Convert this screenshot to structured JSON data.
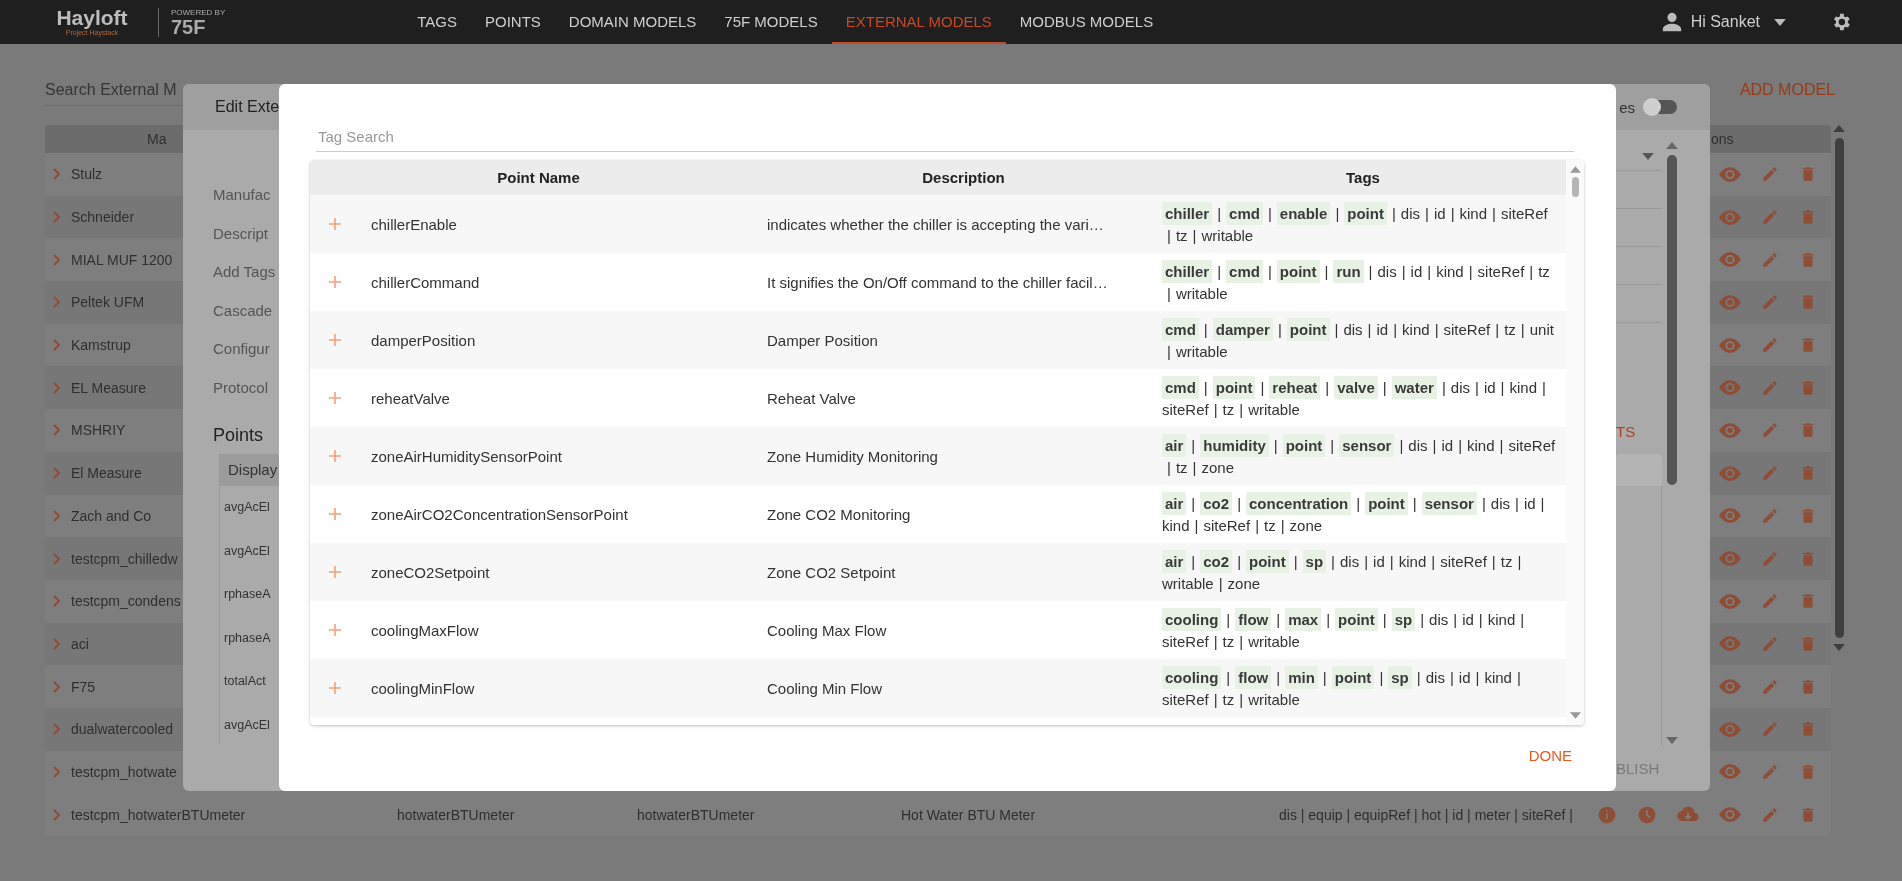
{
  "header": {
    "logo": "Hayloft",
    "logo_subtitle": "Project Haystack",
    "powered_by": "POWERED BY",
    "brand": "75F",
    "nav": [
      {
        "label": "TAGS",
        "selected": false
      },
      {
        "label": "POINTS",
        "selected": false
      },
      {
        "label": "DOMAIN MODELS",
        "selected": false
      },
      {
        "label": "75F MODELS",
        "selected": false
      },
      {
        "label": "EXTERNAL MODELS",
        "selected": true
      },
      {
        "label": "MODBUS MODELS",
        "selected": false
      }
    ],
    "user": "Hi Sanket"
  },
  "page": {
    "search": {
      "placeholder": "Search External M"
    },
    "add_button": "ADD MODEL",
    "table": {
      "header_left": "Ma",
      "header_actions": "ons",
      "rows": [
        {
          "name": "Stulz"
        },
        {
          "name": "Schneider"
        },
        {
          "name": "MIAL MUF 1200"
        },
        {
          "name": "Peltek UFM"
        },
        {
          "name": "Kamstrup"
        },
        {
          "name": "EL Measure"
        },
        {
          "name": "MSHRIY"
        },
        {
          "name": "El Measure"
        },
        {
          "name": "Zach and Co"
        },
        {
          "name": "testcpm_chilledw"
        },
        {
          "name": "testcpm_condens"
        },
        {
          "name": "aci"
        },
        {
          "name": "F75"
        },
        {
          "name": "dualwatercooled"
        },
        {
          "name": "testcpm_hotwate"
        }
      ],
      "last_row": {
        "name": "testcpm_hotwaterBTUmeter",
        "cells": [
          "hotwaterBTUmeter",
          "hotwaterBTUmeter",
          "Hot Water BTU Meter"
        ],
        "tags": "dis | equip | equipRef | hot | id | meter | siteRef |"
      }
    }
  },
  "edit_dialog": {
    "title": "Edit Exte",
    "toggle_label": "es",
    "toggle_on": false,
    "fields": [
      "Manufac",
      "Descript",
      "Add Tags",
      "Cascade",
      "Configur",
      "Protocol"
    ],
    "points_title": "Points",
    "points_header": "Display",
    "points": [
      "avgAcEl",
      "avgAcEl",
      "rphaseA",
      "rphaseA",
      "totalAct",
      "avgAcEl"
    ],
    "add_points": "TS",
    "publish": "BLISH"
  },
  "tag_dialog": {
    "search": {
      "placeholder": "Tag Search"
    },
    "columns": [
      "Point Name",
      "Description",
      "Tags"
    ],
    "separator": "|",
    "rows": [
      {
        "name": "chillerEnable",
        "description": "indicates whether the chiller is accepting the vari…",
        "tags": [
          {
            "name": "chiller",
            "matched": true
          },
          {
            "name": "cmd",
            "matched": true
          },
          {
            "name": "enable",
            "matched": true
          },
          {
            "name": "point",
            "matched": true
          },
          {
            "name": "dis",
            "matched": false
          },
          {
            "name": "id",
            "matched": false
          },
          {
            "name": "kind",
            "matched": false
          },
          {
            "name": "siteRef",
            "matched": false
          },
          {
            "name": "tz",
            "matched": false
          },
          {
            "name": "writable",
            "matched": false
          }
        ]
      },
      {
        "name": "chillerCommand",
        "description": "It signifies the On/Off command to the chiller facil…",
        "tags": [
          {
            "name": "chiller",
            "matched": true
          },
          {
            "name": "cmd",
            "matched": true
          },
          {
            "name": "point",
            "matched": true
          },
          {
            "name": "run",
            "matched": true
          },
          {
            "name": "dis",
            "matched": false
          },
          {
            "name": "id",
            "matched": false
          },
          {
            "name": "kind",
            "matched": false
          },
          {
            "name": "siteRef",
            "matched": false
          },
          {
            "name": "tz",
            "matched": false
          },
          {
            "name": "writable",
            "matched": false
          }
        ]
      },
      {
        "name": "damperPosition",
        "description": "Damper Position",
        "tags": [
          {
            "name": "cmd",
            "matched": true
          },
          {
            "name": "damper",
            "matched": true
          },
          {
            "name": "point",
            "matched": true
          },
          {
            "name": "dis",
            "matched": false
          },
          {
            "name": "id",
            "matched": false
          },
          {
            "name": "kind",
            "matched": false
          },
          {
            "name": "siteRef",
            "matched": false
          },
          {
            "name": "tz",
            "matched": false
          },
          {
            "name": "unit",
            "matched": false
          },
          {
            "name": "writable",
            "matched": false
          }
        ]
      },
      {
        "name": "reheatValve",
        "description": "Reheat Valve",
        "tags": [
          {
            "name": "cmd",
            "matched": true
          },
          {
            "name": "point",
            "matched": true
          },
          {
            "name": "reheat",
            "matched": true
          },
          {
            "name": "valve",
            "matched": true
          },
          {
            "name": "water",
            "matched": true
          },
          {
            "name": "dis",
            "matched": false
          },
          {
            "name": "id",
            "matched": false
          },
          {
            "name": "kind",
            "matched": false
          },
          {
            "name": "siteRef",
            "matched": false
          },
          {
            "name": "tz",
            "matched": false
          },
          {
            "name": "writable",
            "matched": false
          }
        ]
      },
      {
        "name": "zoneAirHumiditySensorPoint",
        "description": "Zone Humidity Monitoring",
        "tags": [
          {
            "name": "air",
            "matched": true
          },
          {
            "name": "humidity",
            "matched": true
          },
          {
            "name": "point",
            "matched": true
          },
          {
            "name": "sensor",
            "matched": true
          },
          {
            "name": "dis",
            "matched": false
          },
          {
            "name": "id",
            "matched": false
          },
          {
            "name": "kind",
            "matched": false
          },
          {
            "name": "siteRef",
            "matched": false
          },
          {
            "name": "tz",
            "matched": false
          },
          {
            "name": "zone",
            "matched": false
          }
        ]
      },
      {
        "name": "zoneAirCO2ConcentrationSensorPoint",
        "description": "Zone CO2 Monitoring",
        "tags": [
          {
            "name": "air",
            "matched": true
          },
          {
            "name": "co2",
            "matched": true
          },
          {
            "name": "concentration",
            "matched": true
          },
          {
            "name": "point",
            "matched": true
          },
          {
            "name": "sensor",
            "matched": true
          },
          {
            "name": "dis",
            "matched": false
          },
          {
            "name": "id",
            "matched": false
          },
          {
            "name": "kind",
            "matched": false
          },
          {
            "name": "siteRef",
            "matched": false
          },
          {
            "name": "tz",
            "matched": false
          },
          {
            "name": "zone",
            "matched": false
          }
        ]
      },
      {
        "name": "zoneCO2Setpoint",
        "description": "Zone CO2 Setpoint",
        "tags": [
          {
            "name": "air",
            "matched": true
          },
          {
            "name": "co2",
            "matched": true
          },
          {
            "name": "point",
            "matched": true
          },
          {
            "name": "sp",
            "matched": true
          },
          {
            "name": "dis",
            "matched": false
          },
          {
            "name": "id",
            "matched": false
          },
          {
            "name": "kind",
            "matched": false
          },
          {
            "name": "siteRef",
            "matched": false
          },
          {
            "name": "tz",
            "matched": false
          },
          {
            "name": "writable",
            "matched": false
          },
          {
            "name": "zone",
            "matched": false
          }
        ]
      },
      {
        "name": "coolingMaxFlow",
        "description": "Cooling Max Flow",
        "tags": [
          {
            "name": "cooling",
            "matched": true
          },
          {
            "name": "flow",
            "matched": true
          },
          {
            "name": "max",
            "matched": true
          },
          {
            "name": "point",
            "matched": true
          },
          {
            "name": "sp",
            "matched": true
          },
          {
            "name": "dis",
            "matched": false
          },
          {
            "name": "id",
            "matched": false
          },
          {
            "name": "kind",
            "matched": false
          },
          {
            "name": "siteRef",
            "matched": false
          },
          {
            "name": "tz",
            "matched": false
          },
          {
            "name": "writable",
            "matched": false
          }
        ]
      },
      {
        "name": "coolingMinFlow",
        "description": "Cooling Min Flow",
        "tags": [
          {
            "name": "cooling",
            "matched": true
          },
          {
            "name": "flow",
            "matched": true
          },
          {
            "name": "min",
            "matched": true
          },
          {
            "name": "point",
            "matched": true
          },
          {
            "name": "sp",
            "matched": true
          },
          {
            "name": "dis",
            "matched": false
          },
          {
            "name": "id",
            "matched": false
          },
          {
            "name": "kind",
            "matched": false
          },
          {
            "name": "siteRef",
            "matched": false
          },
          {
            "name": "tz",
            "matched": false
          },
          {
            "name": "writable",
            "matched": false
          }
        ]
      }
    ],
    "done": "DONE"
  }
}
